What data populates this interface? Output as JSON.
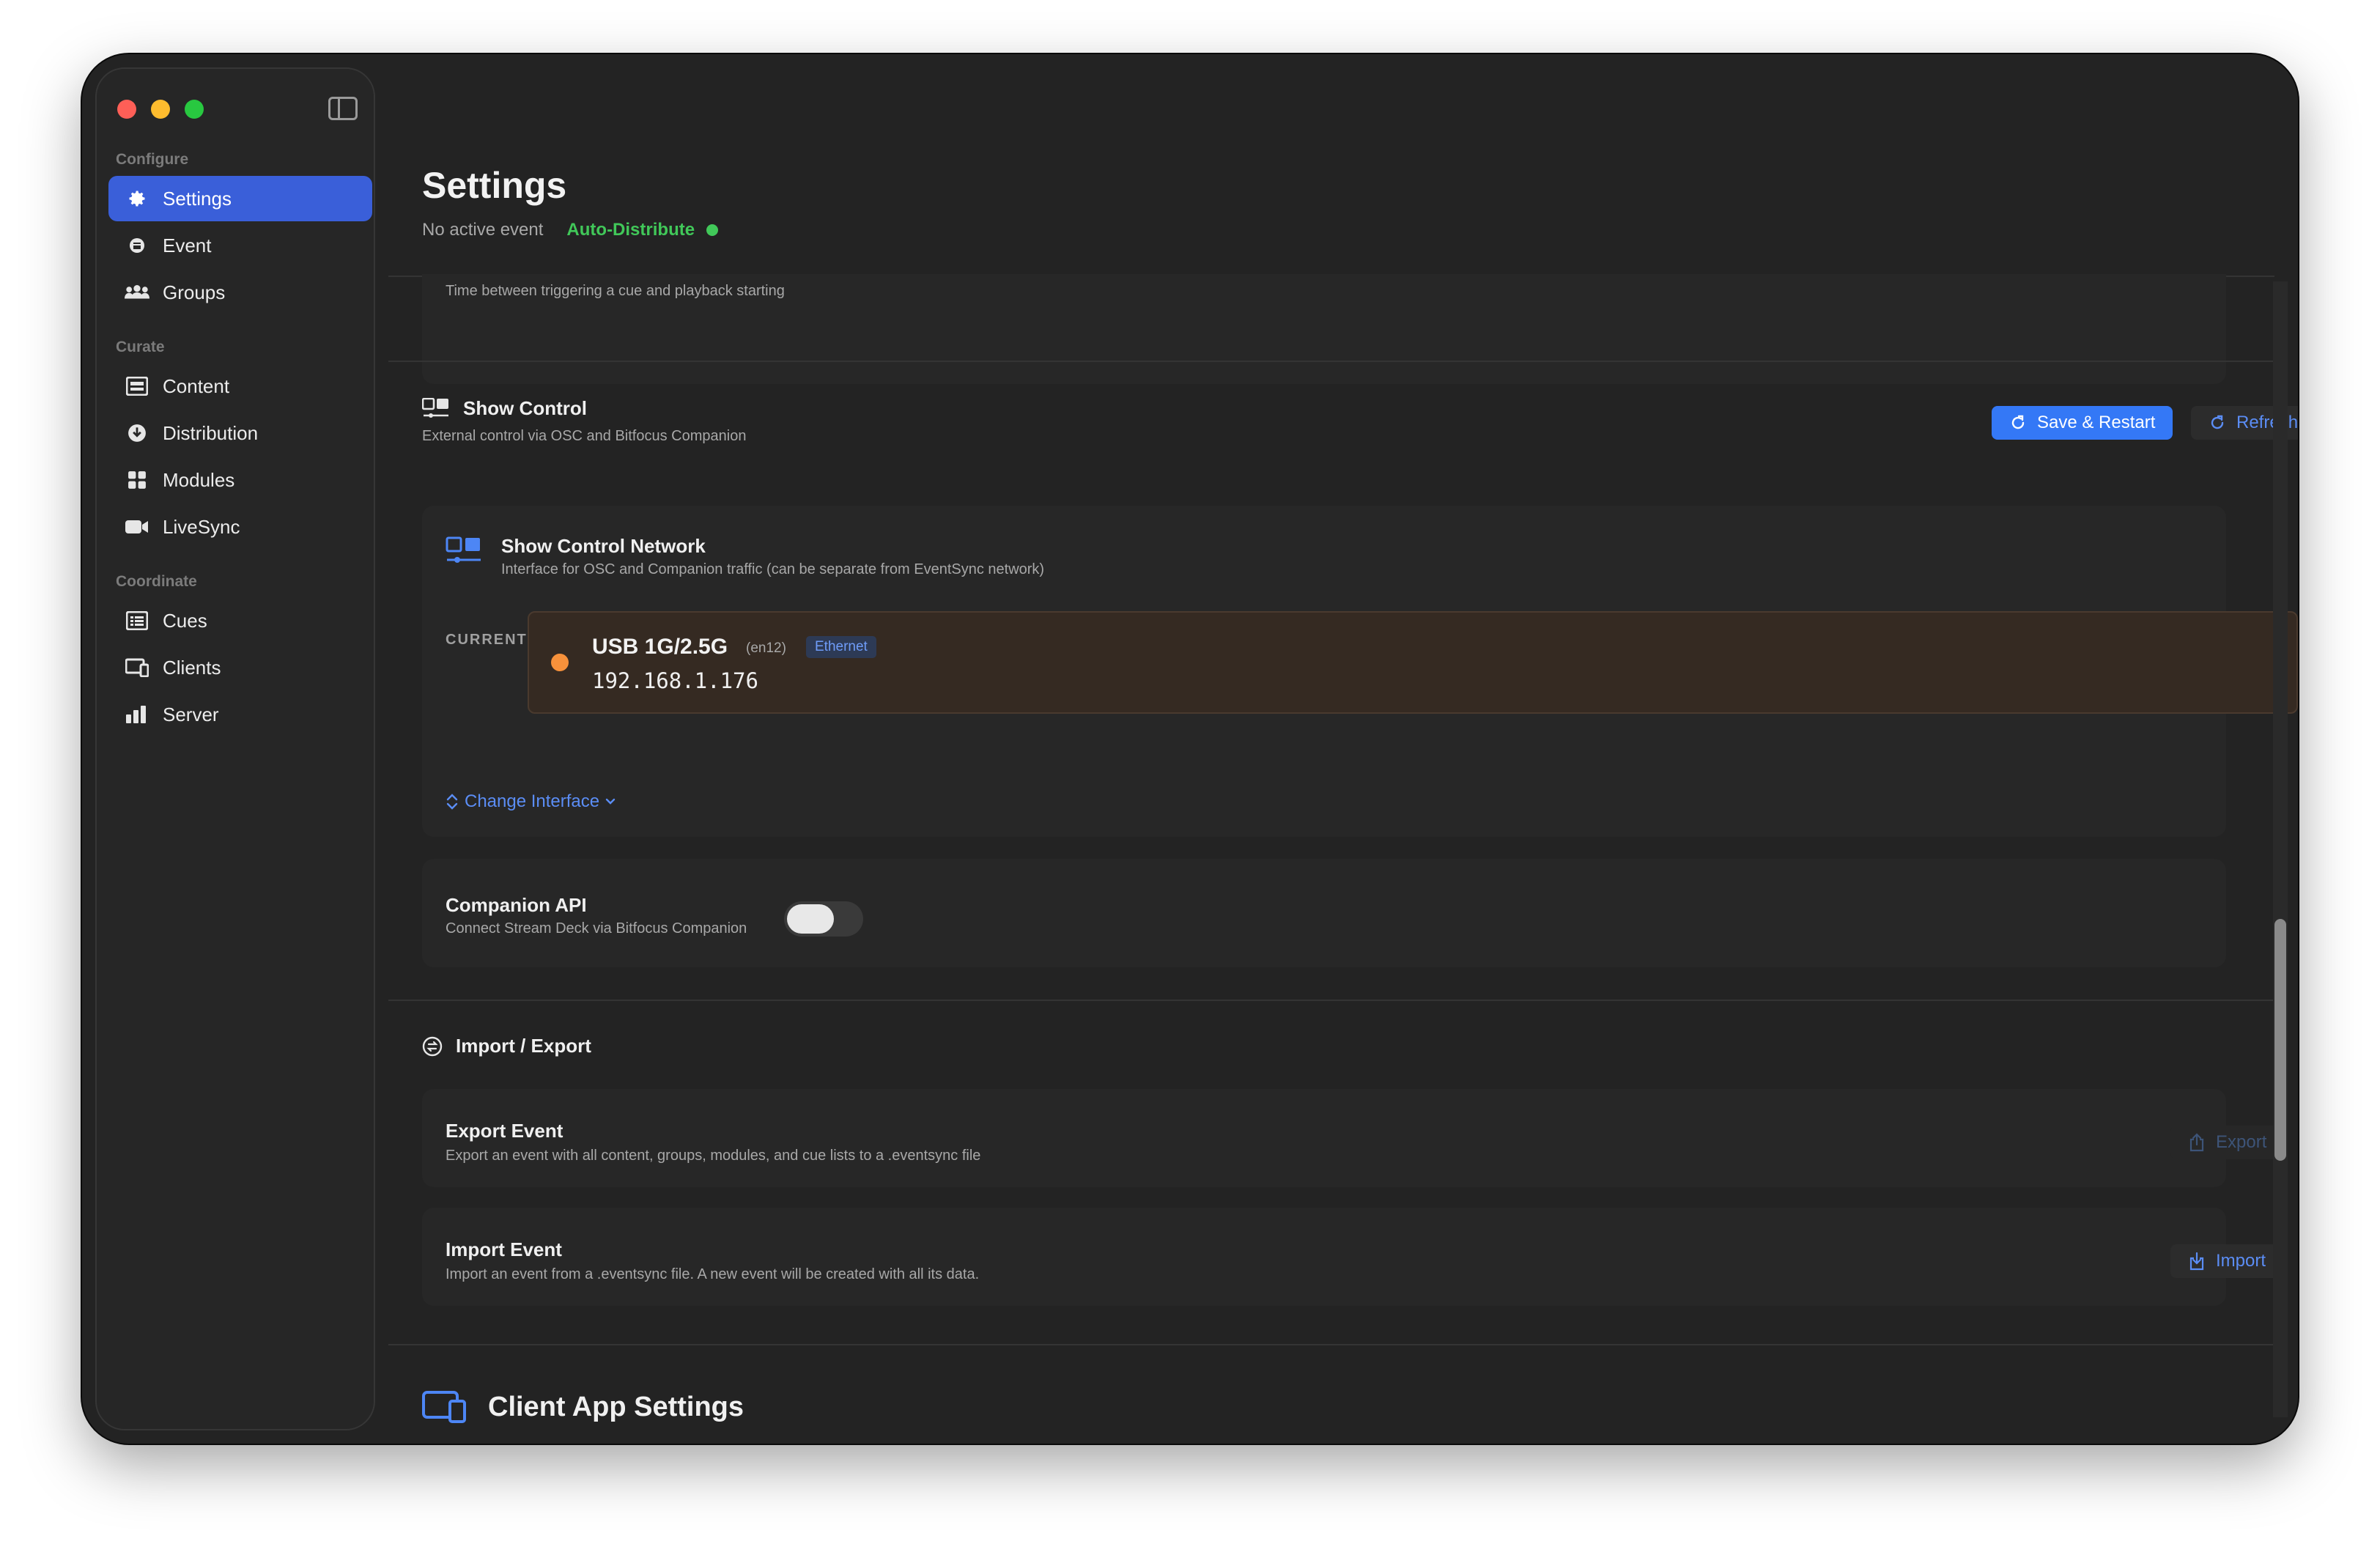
{
  "sidebar": {
    "sections": [
      {
        "label": "Configure"
      },
      {
        "label": "Curate"
      },
      {
        "label": "Coordinate"
      }
    ],
    "items": {
      "settings": "Settings",
      "event": "Event",
      "groups": "Groups",
      "content": "Content",
      "distribution": "Distribution",
      "modules": "Modules",
      "livesync": "LiveSync",
      "cues": "Cues",
      "clients": "Clients",
      "server": "Server"
    }
  },
  "header": {
    "title": "Settings",
    "subtitle": "No active event",
    "auto_distribute": "Auto-Distribute"
  },
  "top_fragment": {
    "description": "Time between triggering a cue and playback starting"
  },
  "show_control": {
    "title": "Show Control",
    "description": "External control via OSC and Bitfocus Companion",
    "save_restart": "Save & Restart",
    "refresh": "Refresh",
    "network": {
      "title": "Show Control Network",
      "description": "Interface for OSC and Companion traffic (can be separate from EventSync network)",
      "current_label": "CURRENT",
      "interface_name": "USB 1G/2.5G",
      "interface_device": "(en12)",
      "interface_type": "Ethernet",
      "interface_ip": "192.168.1.176",
      "change_interface": "Change Interface"
    },
    "companion": {
      "title": "Companion API",
      "description": "Connect Stream Deck via Bitfocus Companion",
      "enabled": false
    }
  },
  "import_export": {
    "title": "Import / Export",
    "export": {
      "title": "Export Event",
      "description": "Export an event with all content, groups, modules, and cue lists to a .eventsync file",
      "button": "Export"
    },
    "import": {
      "title": "Import Event",
      "description": "Import an event from a .eventsync file. A new event will be created with all its data.",
      "button": "Import"
    }
  },
  "client_app": {
    "title": "Client App Settings"
  },
  "colors": {
    "accent": "#3478f6",
    "active_nav": "#3a5fd9",
    "status_green": "#41c859",
    "status_orange": "#f7913b"
  }
}
